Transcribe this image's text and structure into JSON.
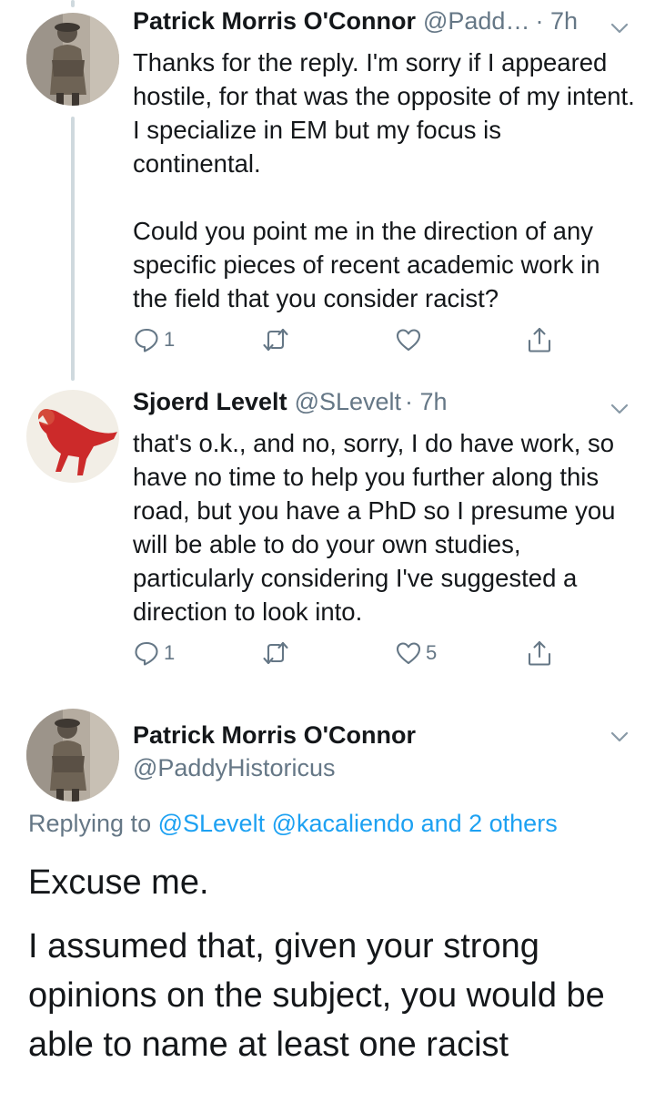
{
  "tweets": [
    {
      "name": "Patrick Morris O'Connor",
      "handle": "@Padd…",
      "time": "· 7h",
      "paragraphs": [
        "Thanks for the reply. I'm sorry if I appeared hostile, for that was the opposite of my intent. I specialize in EM but my focus is continental.",
        "Could you point me in the direction of any specific pieces of recent academic work in the field that you consider racist?"
      ],
      "replies": "1",
      "retweets": "",
      "likes": ""
    },
    {
      "name": "Sjoerd Levelt",
      "handle": "@SLevelt",
      "time": "· 7h",
      "paragraphs": [
        "that's o.k., and no, sorry, I do have work, so have no time to help you further along this road, but you have a PhD so I presume you will be able to do your own studies, particularly considering I've suggested a direction to look into."
      ],
      "replies": "1",
      "retweets": "",
      "likes": "5"
    }
  ],
  "main_tweet": {
    "name": "Patrick Morris O'Connor",
    "handle": "@PaddyHistoricus",
    "replying_prefix": "Replying to",
    "replying_mentions": "@SLevelt @kacaliendo and 2 others",
    "paragraphs": [
      "Excuse me.",
      "I assumed that, given your strong opinions on the subject, you would be able to name at least one racist"
    ]
  },
  "icons": {
    "reply": "reply-icon",
    "retweet": "retweet-icon",
    "like": "heart-icon",
    "share": "share-icon",
    "menu": "chevron-down-icon"
  },
  "colors": {
    "text": "#14171a",
    "secondary": "#657786",
    "link": "#1da1f2",
    "thread_line": "#cfd9de"
  }
}
